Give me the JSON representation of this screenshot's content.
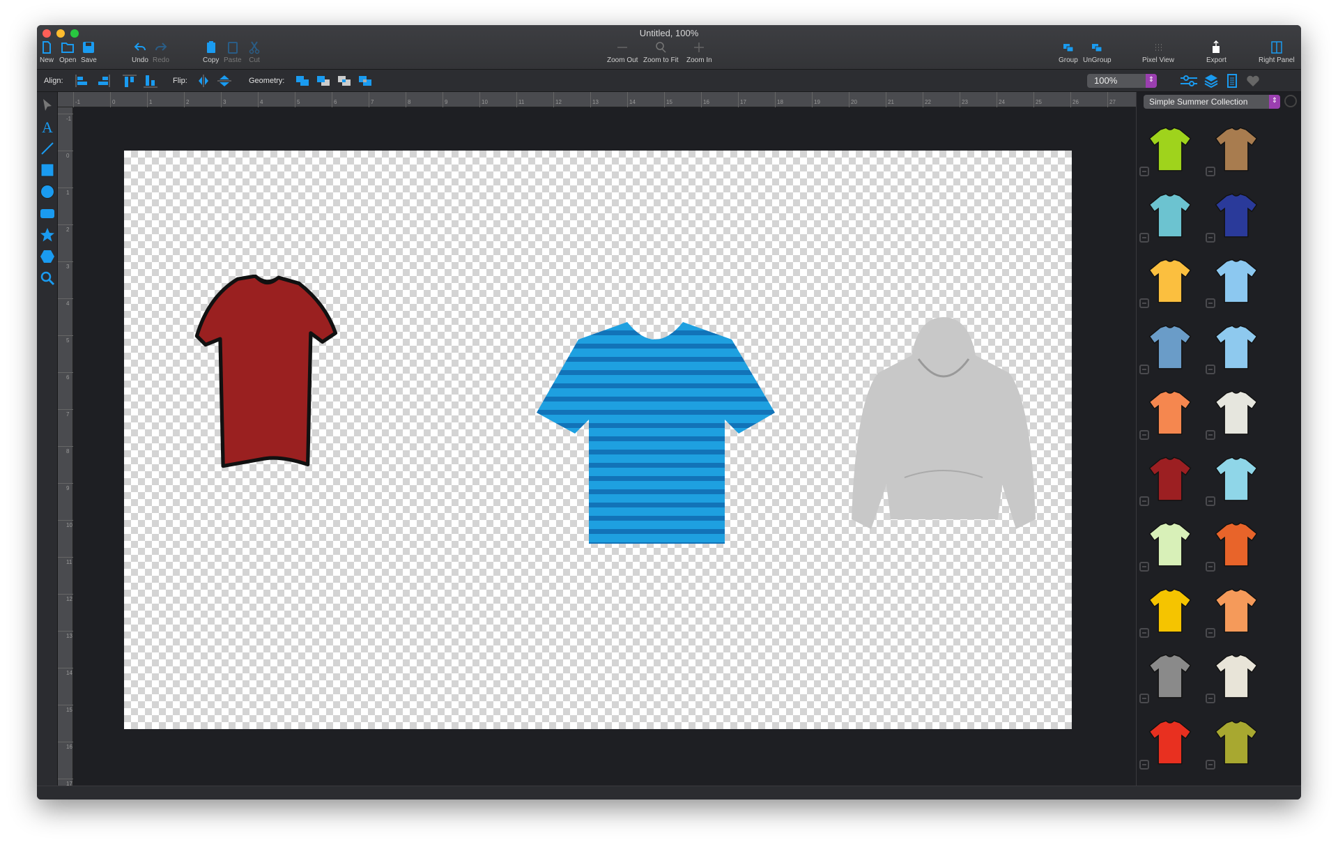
{
  "window": {
    "title": "Untitled, 100%"
  },
  "toolbar": {
    "new": "New",
    "open": "Open",
    "save": "Save",
    "undo": "Undo",
    "redo": "Redo",
    "copy": "Copy",
    "paste": "Paste",
    "cut": "Cut",
    "zoom_out": "Zoom Out",
    "zoom_fit": "Zoom to Fit",
    "zoom_in": "Zoom In",
    "group": "Group",
    "ungroup": "UnGroup",
    "pixel_view": "Pixel View",
    "export": "Export",
    "right_panel": "Right Panel"
  },
  "alignbar": {
    "align_label": "Align:",
    "flip_label": "Flip:",
    "geometry_label": "Geometry:",
    "zoom_value": "100%"
  },
  "tools": [
    "select-arrow",
    "text",
    "line",
    "rectangle",
    "circle",
    "rounded-rectangle",
    "star",
    "hexagon",
    "zoom"
  ],
  "rulers": {
    "horizontal": [
      "-1",
      "0",
      "1",
      "2",
      "3",
      "4",
      "5",
      "6",
      "7",
      "8",
      "9",
      "10",
      "11",
      "12",
      "13",
      "14",
      "15",
      "16",
      "17",
      "18",
      "19",
      "20",
      "21",
      "22",
      "23",
      "24",
      "25",
      "26",
      "27"
    ],
    "vertical": [
      "-1",
      "0",
      "1",
      "2",
      "3",
      "4",
      "5",
      "6",
      "7",
      "8",
      "9",
      "10",
      "11",
      "12",
      "13",
      "14",
      "15",
      "16",
      "17"
    ]
  },
  "right_panel": {
    "collection": "Simple Summer Collection",
    "items": [
      {
        "name": "green-tshirt",
        "color": "#9fd31c"
      },
      {
        "name": "tan-tshirt",
        "color": "#a87c4f"
      },
      {
        "name": "teal-tank-top",
        "color": "#6cc3d0"
      },
      {
        "name": "navy-raglan-shirt",
        "color": "#2a3a9a"
      },
      {
        "name": "yellow-tshirt",
        "color": "#fbbf3f"
      },
      {
        "name": "light-blue-tshirt",
        "color": "#8cc8f0"
      },
      {
        "name": "steel-blue-tshirt",
        "color": "#6a9cc8"
      },
      {
        "name": "light-blue-vneck",
        "color": "#8ec9ee"
      },
      {
        "name": "orange-tank-top",
        "color": "#f5874f"
      },
      {
        "name": "white-tshirt",
        "color": "#e6e6de"
      },
      {
        "name": "dark-red-tshirt",
        "color": "#9c1f22"
      },
      {
        "name": "cyan-tshirt",
        "color": "#8fd6e8"
      },
      {
        "name": "light-green-tshirt",
        "color": "#d8f0b8"
      },
      {
        "name": "orange-vneck",
        "color": "#e8642a"
      },
      {
        "name": "yellow-polo",
        "color": "#f5c400"
      },
      {
        "name": "peach-tshirt",
        "color": "#f59a5a"
      },
      {
        "name": "gray-long-sleeve",
        "color": "#8a8a8a"
      },
      {
        "name": "cream-tshirt",
        "color": "#e8e4d8"
      },
      {
        "name": "red-tshirt",
        "color": "#e83020"
      },
      {
        "name": "olive-tshirt",
        "color": "#a8a830"
      }
    ]
  },
  "canvas": {
    "objects": [
      {
        "name": "red-tshirt",
        "color": "#9a2020"
      },
      {
        "name": "blue-striped-tshirt",
        "color": "#1ea0e0",
        "stripe": "#1273b8"
      },
      {
        "name": "gray-hoodie",
        "color": "#c8c8c8"
      }
    ]
  },
  "colors": {
    "accent": "#1a9bf0",
    "stepper": "#9b3fb0"
  }
}
